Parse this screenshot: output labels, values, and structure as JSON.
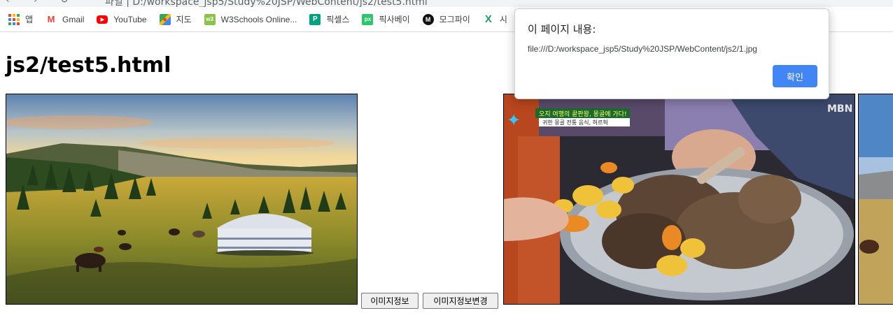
{
  "browser": {
    "url_partial": "파일 | D:/workspace_jsp5/Study%20JSP/WebContent/js2/test5.html",
    "bookmarks": [
      {
        "label": "앱",
        "icon": "apps-grid-icon"
      },
      {
        "label": "Gmail",
        "icon": "gmail-icon"
      },
      {
        "label": "YouTube",
        "icon": "youtube-icon"
      },
      {
        "label": "지도",
        "icon": "maps-icon"
      },
      {
        "label": "W3Schools Online...",
        "icon": "w3schools-icon"
      },
      {
        "label": "픽셀스",
        "icon": "pexels-icon"
      },
      {
        "label": "픽사베이",
        "icon": "pixabay-icon"
      },
      {
        "label": "모그파이",
        "icon": "mogfy-icon"
      },
      {
        "label": "시",
        "icon": "x-icon"
      }
    ]
  },
  "page": {
    "title": "js2/test5.html",
    "buttons": {
      "info": "이미지정보",
      "change": "이미지정보변경"
    }
  },
  "dialog": {
    "title": "이 페이지 내용:",
    "message": "file:///D:/workspace_jsp5/Study%20JSP/WebContent/js2/1.jpg",
    "ok_label": "확인"
  },
  "images": {
    "food_caption_top": "오지 여행의 끝판왕, 몽골에 가다!",
    "food_caption_bottom": "귀한 몽골 전통 음식, 허르헉",
    "food_logo": "MBN"
  },
  "colors": {
    "dialog_button": "#4285f4",
    "gmail": "#ea4335",
    "youtube": "#ff0000",
    "w3schools": "#8bc34a",
    "pexels": "#05a081",
    "pixabay": "#2ec66d"
  }
}
